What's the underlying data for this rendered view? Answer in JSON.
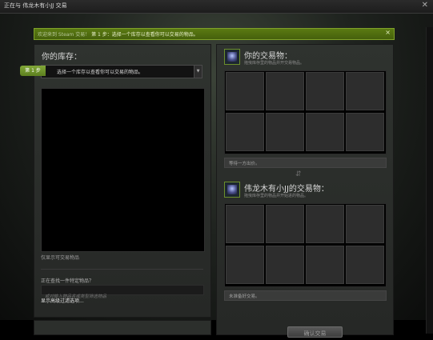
{
  "window": {
    "title": "正在与 伟龙木有小JJ 交易",
    "close_glyph": "✕"
  },
  "banner": {
    "prefix": "欢迎来到 Steam 交易！",
    "text": "第 1 步：选择一个库存以查看你可以交易的物品。",
    "close_glyph": "×"
  },
  "inventory": {
    "title": "你的库存：",
    "step_badge": "第 1 步",
    "select_value": "选择一个库存以查看你可以交易的物品。",
    "show_tradable": "仅显示可交易物品",
    "find_label": "正在查找一件特定物品？",
    "search_placeholder": "或对输入物品名或类型筛选物品",
    "advanced_link": "显示高级过滤选项..."
  },
  "your_offer": {
    "title": "你的交易物：",
    "subtitle": "拖曳库存里的物品并开交易物品。",
    "status": "等待一方出价。"
  },
  "their_offer": {
    "title": "伟龙木有小JJ的交易物：",
    "subtitle": "拖曳库存里的物品并开始进的物品。",
    "status": "未准备好交易。"
  },
  "swap_icon": "⇵",
  "confirm_button": "确认交易",
  "colors": {
    "accent_green": "#5b7a12",
    "panel": "#2c2f2c",
    "slot": "#2d2d2d"
  }
}
